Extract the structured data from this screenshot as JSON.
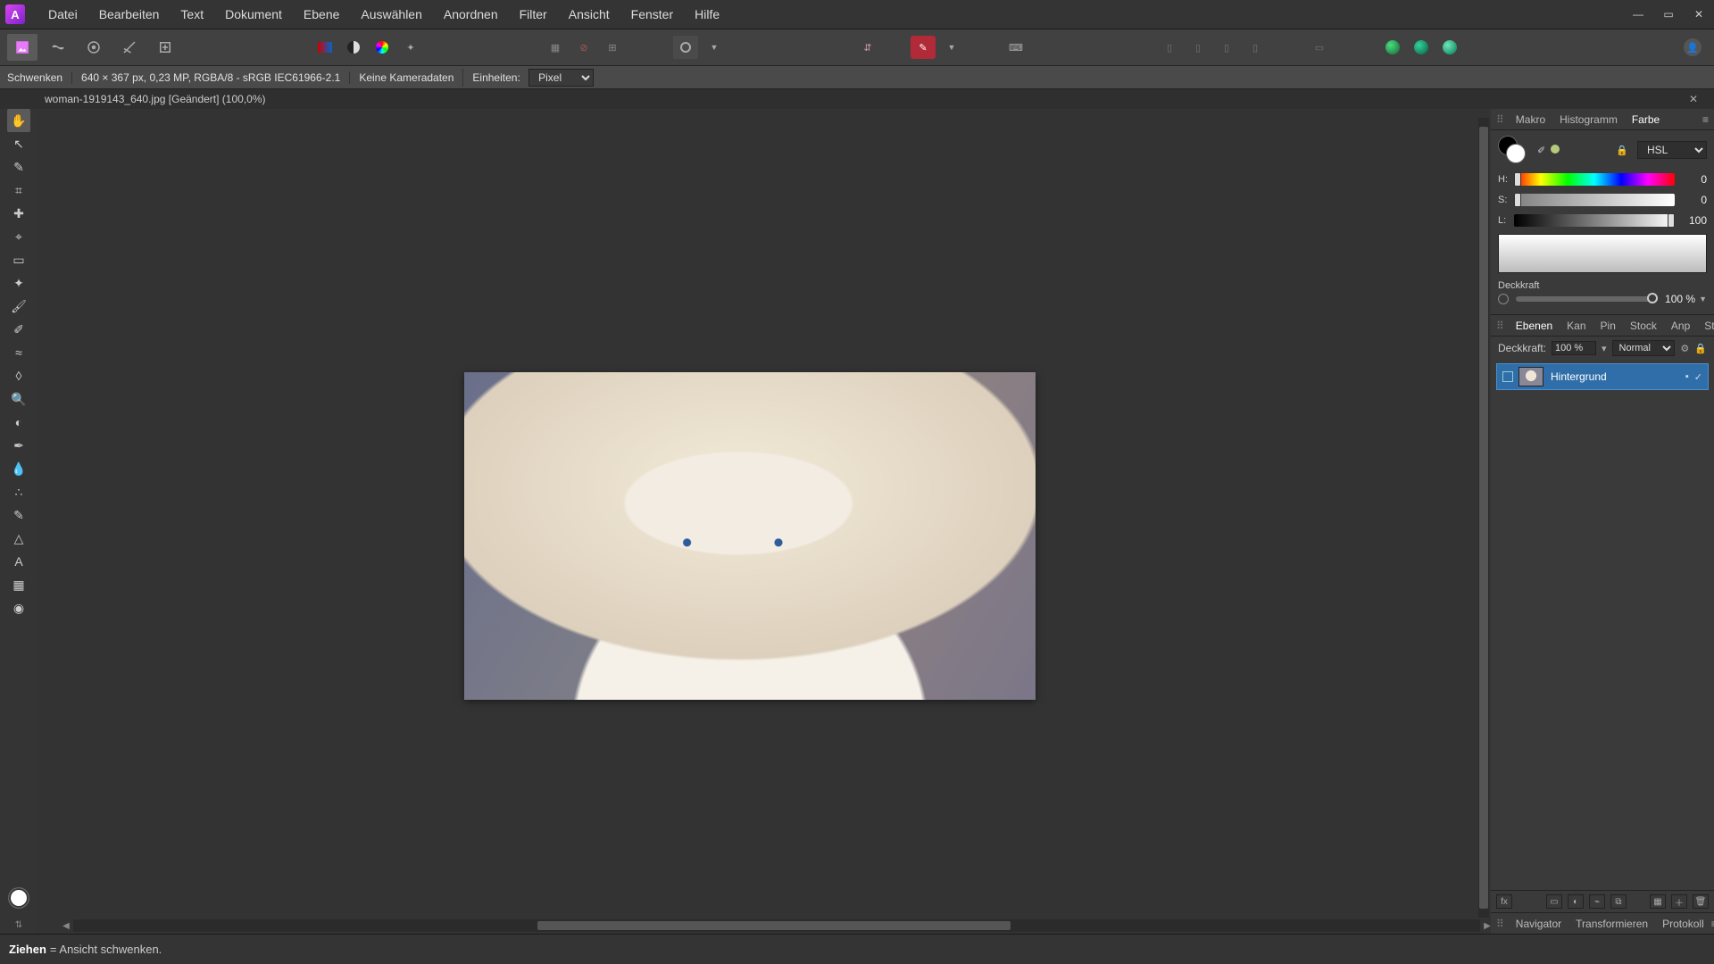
{
  "app_icon_letter": "A",
  "menu": [
    "Datei",
    "Bearbeiten",
    "Text",
    "Dokument",
    "Ebene",
    "Auswählen",
    "Anordnen",
    "Filter",
    "Ansicht",
    "Fenster",
    "Hilfe"
  ],
  "info": {
    "tool": "Schwenken",
    "dims": "640 × 367 px, 0,23 MP, RGBA/8 - sRGB IEC61966-2.1",
    "camera": "Keine Kameradaten",
    "units_label": "Einheiten:",
    "units_value": "Pixel"
  },
  "doc_tab": "woman-1919143_640.jpg [Geändert] (100,0%)",
  "right_tabs_top": [
    "Makro",
    "Histogramm",
    "Farbe"
  ],
  "right_tabs_top_active": 2,
  "color_model": "HSL",
  "hsl": {
    "h_label": "H:",
    "s_label": "S:",
    "l_label": "L:",
    "h": "0",
    "s": "0",
    "l": "100"
  },
  "opacity": {
    "label": "Deckkraft",
    "value": "100 %"
  },
  "right_tabs_mid": [
    "Ebenen",
    "Kan",
    "Pin",
    "Stock",
    "Anp",
    "Stile"
  ],
  "right_tabs_mid_active": 0,
  "layer_header": {
    "label": "Deckkraft:",
    "value": "100 %",
    "blend": "Normal"
  },
  "layer_item": {
    "name": "Hintergrund"
  },
  "right_tabs_bottom": [
    "Navigator",
    "Transformieren",
    "Protokoll"
  ],
  "status": {
    "bold": "Ziehen",
    "rest": "= Ansicht schwenken."
  },
  "left_tools": [
    {
      "name": "hand-tool",
      "glyph": "✋",
      "active": true
    },
    {
      "name": "move-tool",
      "glyph": "↖"
    },
    {
      "name": "brush-tool",
      "glyph": "✎"
    },
    {
      "name": "crop-tool",
      "glyph": "⌗"
    },
    {
      "name": "heal-tool",
      "glyph": "✚"
    },
    {
      "name": "clone-tool",
      "glyph": "⌖"
    },
    {
      "name": "marquee-tool",
      "glyph": "▭"
    },
    {
      "name": "flood-select-tool",
      "glyph": "✦"
    },
    {
      "name": "paint-brush-tool",
      "glyph": "🖌"
    },
    {
      "name": "pencil-tool",
      "glyph": "✐"
    },
    {
      "name": "color-replace-tool",
      "glyph": "≈"
    },
    {
      "name": "eraser-tool",
      "glyph": "◊"
    },
    {
      "name": "zoom-tool",
      "glyph": "🔍"
    },
    {
      "name": "dodge-tool",
      "glyph": "◐"
    },
    {
      "name": "pen-tool",
      "glyph": "✒"
    },
    {
      "name": "smudge-tool",
      "glyph": "💧"
    },
    {
      "name": "sponge-tool",
      "glyph": "∴"
    },
    {
      "name": "burn-tool",
      "glyph": "✎"
    },
    {
      "name": "shape-tool",
      "glyph": "△"
    },
    {
      "name": "text-tool",
      "glyph": "A"
    },
    {
      "name": "mesh-tool",
      "glyph": "▦"
    },
    {
      "name": "picker-tool",
      "glyph": "◉"
    }
  ]
}
